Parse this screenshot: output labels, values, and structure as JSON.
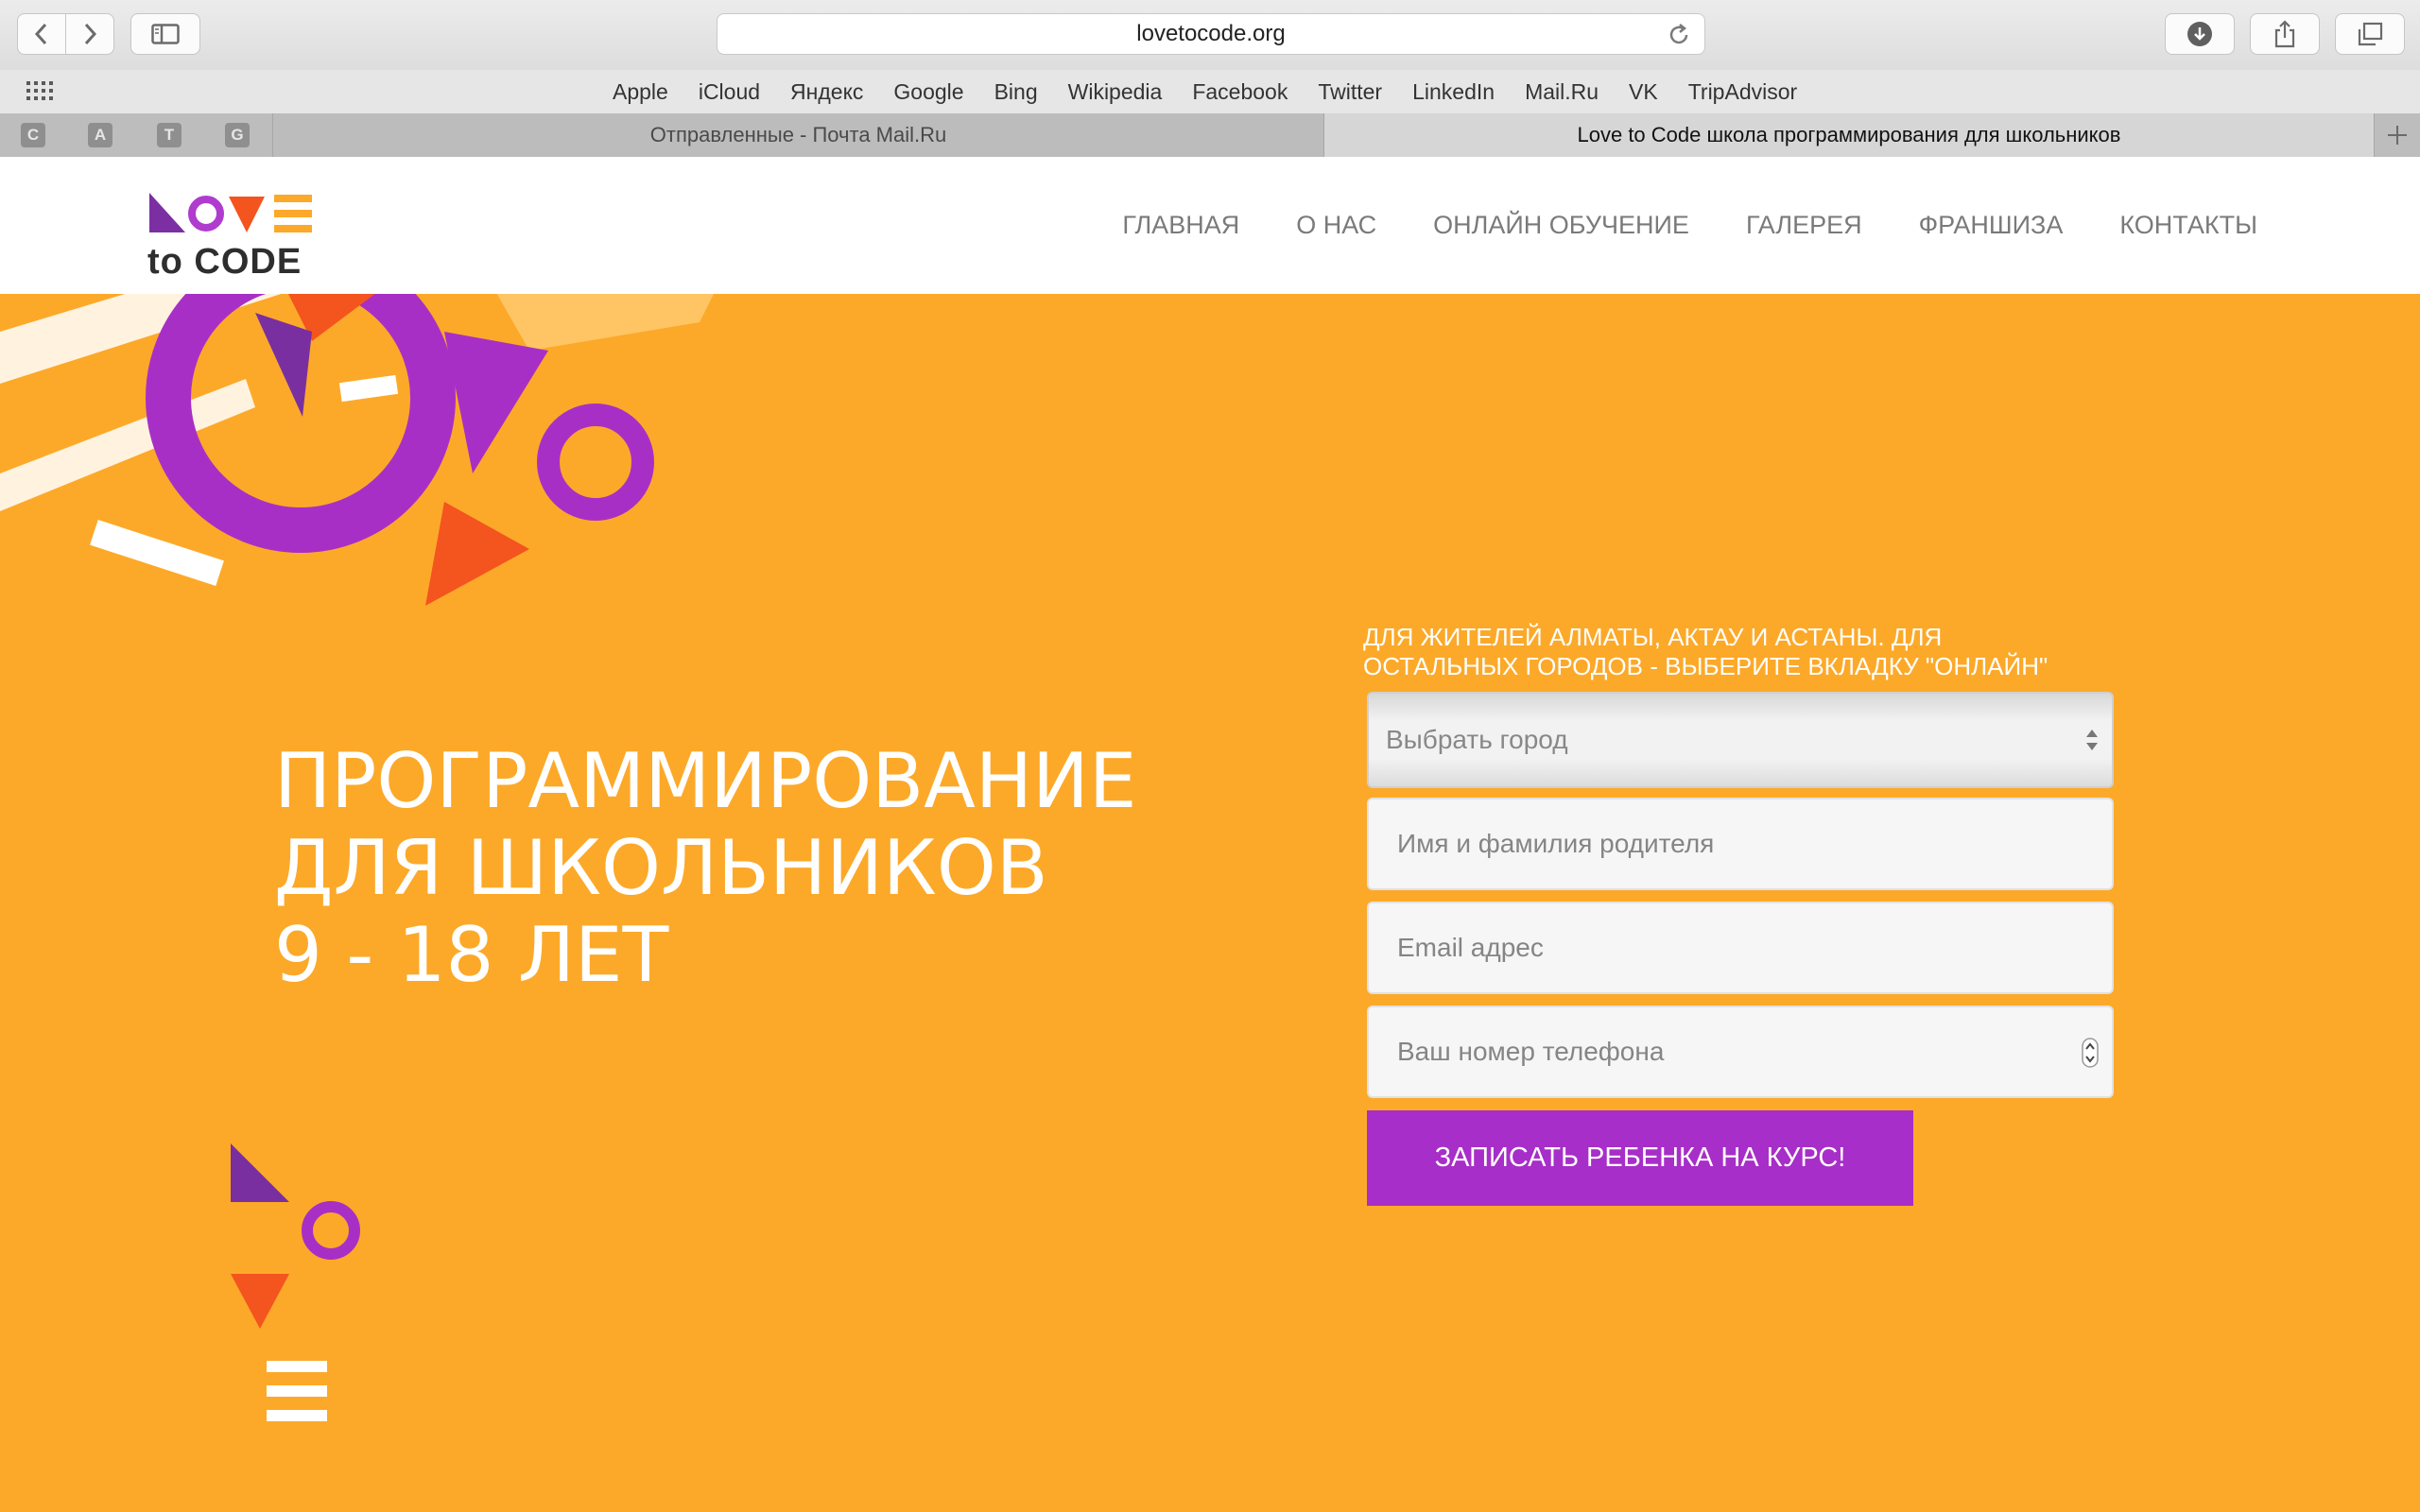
{
  "browser": {
    "url": "lovetocode.org",
    "bookmarks": [
      "Apple",
      "iCloud",
      "Яндекс",
      "Google",
      "Bing",
      "Wikipedia",
      "Facebook",
      "Twitter",
      "LinkedIn",
      "Mail.Ru",
      "VK",
      "TripAdvisor"
    ],
    "pinned_tabs": [
      "C",
      "A",
      "T",
      "G"
    ],
    "tabs": [
      {
        "title": "Отправленные - Почта Mail.Ru",
        "active": false
      },
      {
        "title": "Love to Code школа программирования для школьников",
        "active": true
      }
    ]
  },
  "site": {
    "logo_word": "LOVE",
    "logo_sub": "to CODE",
    "nav": [
      "ГЛАВНАЯ",
      "О НАС",
      "ОНЛАЙН ОБУЧЕНИЕ",
      "ГАЛЕРЕЯ",
      "ФРАНШИЗА",
      "КОНТАКТЫ"
    ],
    "colors": {
      "brand_orange": "#fca929",
      "brand_purple": "#a72ec8",
      "accent_red": "#f4541e"
    }
  },
  "hero": {
    "headline": [
      "ПРОГРАММИРОВАНИЕ",
      "ДЛЯ ШКОЛЬНИКОВ",
      "9 - 18 ЛЕТ"
    ],
    "form": {
      "note_line1": "ДЛЯ ЖИТЕЛЕЙ АЛМАТЫ, АКТАУ И АСТАНЫ. ДЛЯ",
      "note_line2": "ОСТАЛЬНЫХ ГОРОДОВ - ВЫБЕРИТЕ ВКЛАДКУ \"ОНЛАЙН\"",
      "city_placeholder": "Выбрать город",
      "name_placeholder": "Имя и фамилия родителя",
      "email_placeholder": "Email адрес",
      "phone_placeholder": "Ваш номер телефона",
      "submit_label": "ЗАПИСАТЬ РЕБЕНКА НА КУРС!"
    }
  }
}
